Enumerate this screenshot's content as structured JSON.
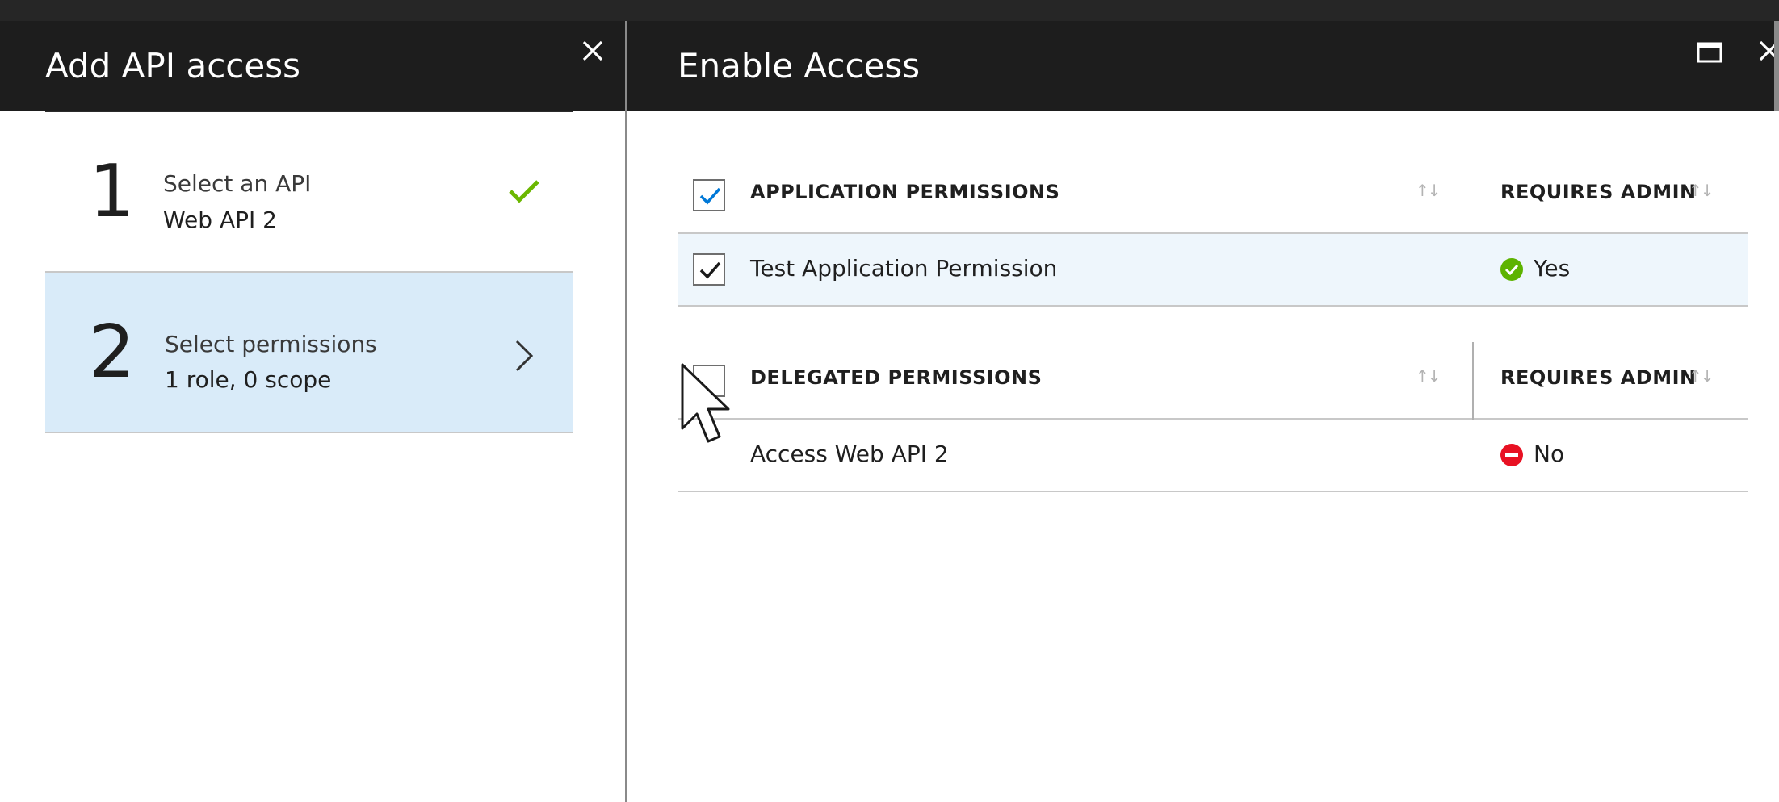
{
  "colors": {
    "header_bg": "#1d1d1d",
    "selected_step_bg": "#d9ebf9",
    "check_green": "#6bb700",
    "yes_green": "#5db300",
    "no_red": "#e81123",
    "checkbox_blue": "#0078d7"
  },
  "left_blade": {
    "title": "Add API access",
    "close_icon": "close-icon",
    "steps": [
      {
        "number": "1",
        "label": "Select an API",
        "value": "Web API 2",
        "status_icon": "checkmark-icon",
        "completed": true
      },
      {
        "number": "2",
        "label": "Select permissions",
        "value": "1 role, 0 scope",
        "nav_icon": "chevron-right-icon",
        "selected": true
      }
    ]
  },
  "right_blade": {
    "title": "Enable Access",
    "maximize_icon": "maximize-icon",
    "close_icon": "close-icon",
    "application_permissions": {
      "header": "APPLICATION PERMISSIONS",
      "admin_header": "REQUIRES ADMIN",
      "header_checked": true,
      "rows": [
        {
          "name": "Test Application Permission",
          "checked": true,
          "requires_admin": "Yes",
          "admin_icon": "green-check-circle-icon"
        }
      ]
    },
    "delegated_permissions": {
      "header": "DELEGATED PERMISSIONS",
      "admin_header": "REQUIRES ADMIN",
      "header_checked": false,
      "rows": [
        {
          "name": "Access Web API 2",
          "checked": false,
          "requires_admin": "No",
          "admin_icon": "red-minus-circle-icon"
        }
      ]
    }
  }
}
